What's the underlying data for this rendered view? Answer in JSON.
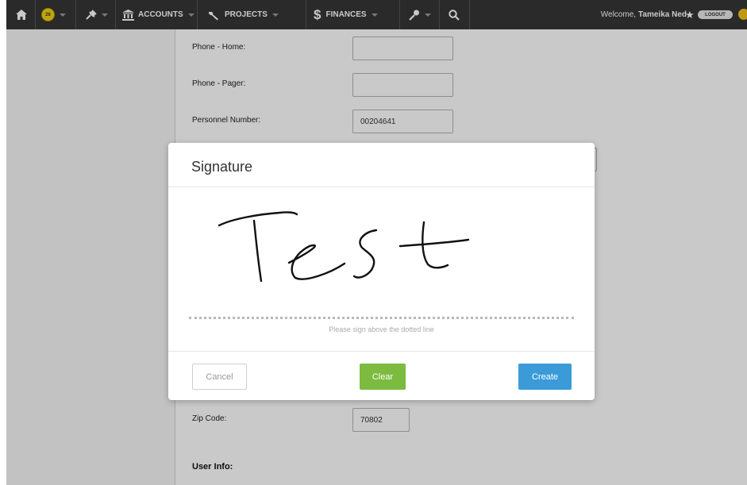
{
  "topbar": {
    "badge_text": "26",
    "accounts_label": "ACCOUNTS",
    "projects_label": "PROJECTS",
    "finances_label": "FINANCES",
    "welcome_label": "Welcome,",
    "user_name": "Tameika Ned",
    "logout_label": "LOGOUT"
  },
  "form": {
    "fields": [
      {
        "label": "Phone - Home:",
        "value": ""
      },
      {
        "label": "Phone - Pager:",
        "value": ""
      },
      {
        "label": "Personnel Number:",
        "value": "00204641"
      },
      {
        "label": "Zip Code:",
        "value": "70802"
      }
    ],
    "section_title": "User Info:"
  },
  "modal": {
    "title": "Signature",
    "signature_text": "Test",
    "hint": "Please sign above the dotted line",
    "cancel_label": "Cancel",
    "clear_label": "Clear",
    "create_label": "Create"
  },
  "colors": {
    "nav_bar": "#363636",
    "clear_button": "#7cbb3f",
    "create_button": "#3a9bd8",
    "badge": "#f4d31c"
  }
}
